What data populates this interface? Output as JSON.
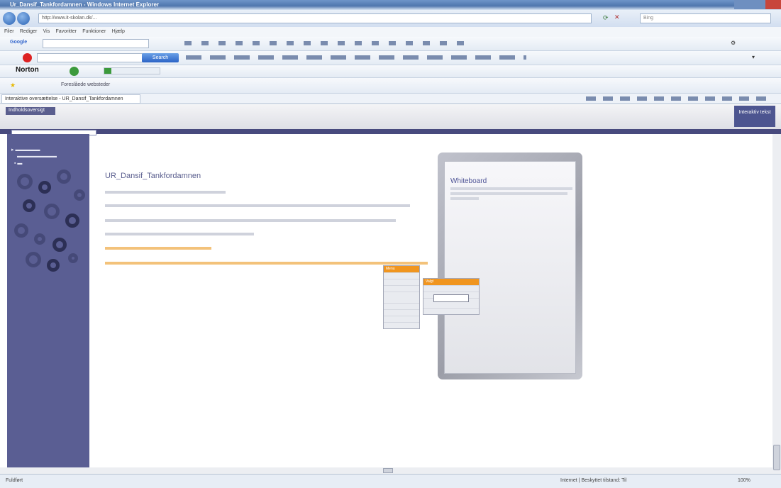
{
  "window": {
    "title": "Ur_Dansif_Tankfordamnen - Windows Internet Explorer"
  },
  "address": {
    "url": "http://www.it-skolan.dk/..."
  },
  "search": {
    "placeholder": "Bing"
  },
  "menu": [
    "Filer",
    "Rediger",
    "Vis",
    "Favoritter",
    "Funktioner",
    "Hjælp"
  ],
  "toolbar_google": {
    "brand": "Google",
    "search_label": "Search"
  },
  "toolbar_norton": {
    "brand": "Norton"
  },
  "favorites_bar": {
    "label": "Foreslåede websteder"
  },
  "tab": {
    "label": "Interaktive oversættelse - UR_Dansif_Tankfordamnen"
  },
  "page": {
    "header_label": "Indholdsoversigt",
    "brand": "Interaktiv tekst",
    "title": "UR_Dansif_Tankfordamnen",
    "colors": {
      "accent": "#5a5e8e",
      "highlight": "#f0a030",
      "panel": "#5a5e93"
    }
  },
  "whiteboard": {
    "title": "Whiteboard"
  },
  "context_menu": {
    "main_header": "Menu",
    "sub_header": "Valgt"
  },
  "statusbar": {
    "status": "Fuldført",
    "zone": "Internet | Beskyttet tilstand: Til",
    "zoom": "100%"
  }
}
